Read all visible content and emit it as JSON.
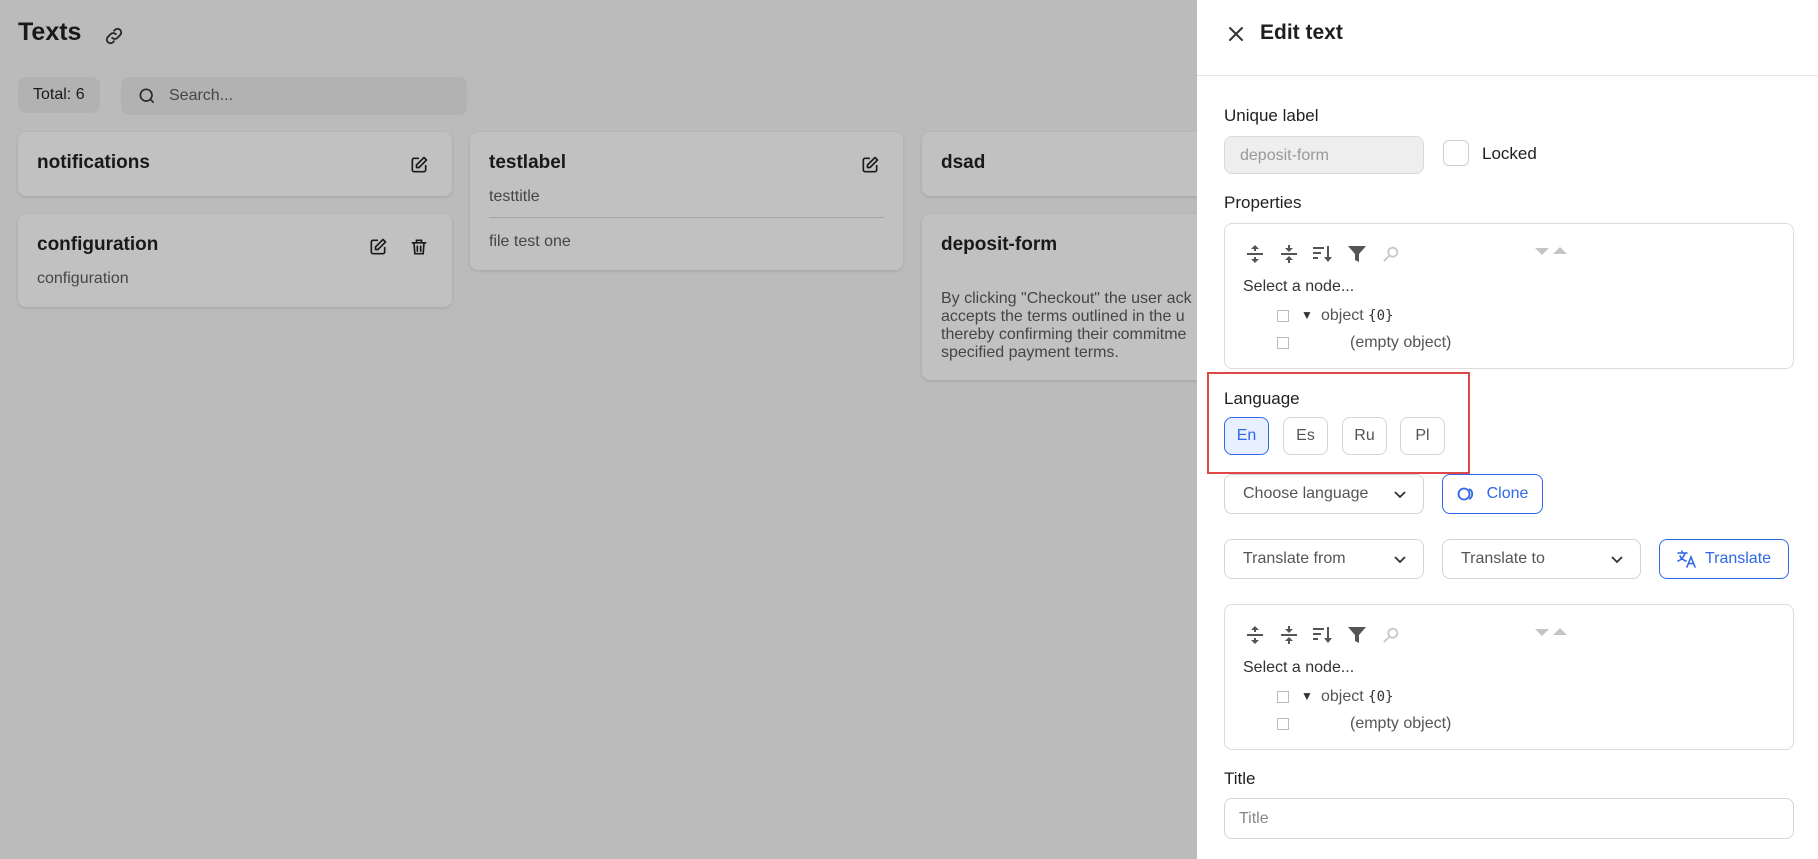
{
  "page": {
    "title": "Texts",
    "total_label": "Total: 6",
    "search_placeholder": "Search..."
  },
  "cards": [
    {
      "title": "notifications"
    },
    {
      "title": "testlabel",
      "subtitle": "testtitle",
      "body": "file test one"
    },
    {
      "title": "dsad"
    },
    {
      "title": "configuration",
      "subtitle": "configuration"
    },
    {
      "title": "deposit-form",
      "paragraph": [
        "By clicking \"Checkout\" the user ack",
        "accepts the terms outlined in the u",
        "thereby confirming their commitme",
        "specified payment terms."
      ]
    }
  ],
  "drawer": {
    "title": "Edit text",
    "unique_label": "Unique label",
    "unique_value": "deposit-form",
    "locked_label": "Locked",
    "properties_label": "Properties",
    "language_label": "Language",
    "languages": [
      "En",
      "Es",
      "Ru",
      "Pl"
    ],
    "active_language": "En",
    "choose_language_placeholder": "Choose language",
    "clone_label": "Clone",
    "translate_from_placeholder": "Translate from",
    "translate_to_placeholder": "Translate to",
    "translate_label": "Translate",
    "title_label": "Title",
    "title_placeholder": "Title",
    "json_editor": {
      "select_node": "Select a node...",
      "object_key": "object",
      "object_count": "{0}",
      "empty_object": "(empty object)"
    }
  },
  "colors": {
    "accent": "#2f68e8",
    "highlight": "#e04848"
  }
}
